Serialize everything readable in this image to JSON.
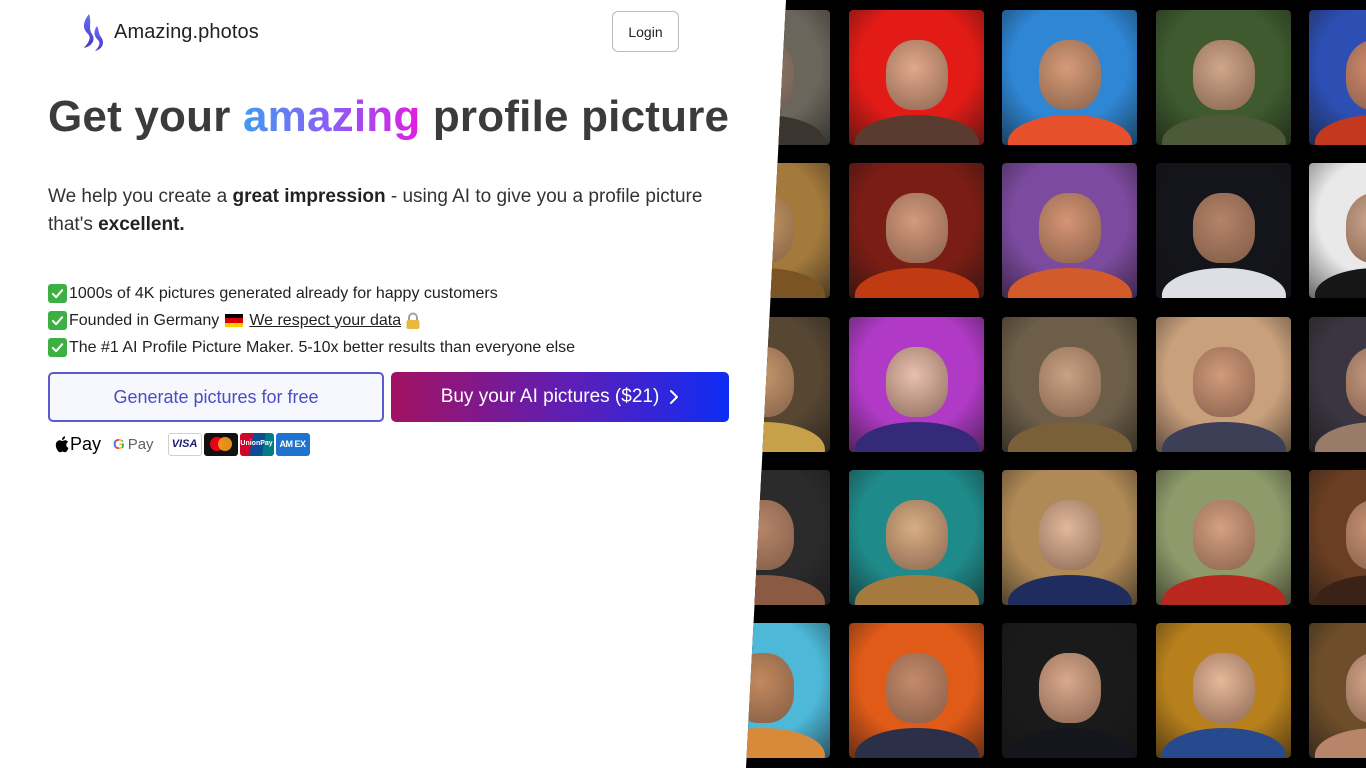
{
  "header": {
    "brand": "Amazing.photos",
    "login_label": "Login"
  },
  "hero": {
    "title_part1": "Get your ",
    "title_highlight": "amazing",
    "title_part2": " profile picture",
    "subtitle_part1": "We help you create a ",
    "subtitle_bold1": "great impression",
    "subtitle_part2": " - using AI to give you a profile picture that's ",
    "subtitle_bold2": "excellent."
  },
  "features": [
    {
      "text": "1000s of 4K pictures generated already for happy customers"
    },
    {
      "text": "Founded in Germany",
      "link": "We respect your data"
    },
    {
      "text": "The #1 AI Profile Picture Maker. 5-10x better results than everyone else"
    }
  ],
  "cta": {
    "free_label": "Generate pictures for free",
    "buy_label": "Buy your AI pictures ($21)"
  },
  "payments": {
    "apple_pay": "Pay",
    "google_pay": "Pay",
    "visa": "VISA",
    "unionpay": "UnionPay",
    "amex": "AM EX"
  },
  "gallery": {
    "tiles": [
      {
        "bg": "#6b665c",
        "face": "#8d8072",
        "shirt": "#3a352f"
      },
      {
        "bg": "#e21b16",
        "face": "#e2a88a",
        "shirt": "#5a3b30"
      },
      {
        "bg": "#2e86d4",
        "face": "#d69b78",
        "shirt": "#e6502a"
      },
      {
        "bg": "#3e5a2e",
        "face": "#cfa78a",
        "shirt": "#4d5a3a"
      },
      {
        "bg": "#2d4fb3",
        "face": "#d28c6d",
        "shirt": "#c2391f"
      },
      {
        "bg": "#a37a3c",
        "face": "#c99a64",
        "shirt": "#7a5424"
      },
      {
        "bg": "#7a1d14",
        "face": "#d49a7c",
        "shirt": "#c13b12"
      },
      {
        "bg": "#7c4a9e",
        "face": "#d59574",
        "shirt": "#d35a2a"
      },
      {
        "bg": "#14151a",
        "face": "#b58468",
        "shirt": "#dddfe5"
      },
      {
        "bg": "#e9e9e9",
        "face": "#cfa88e",
        "shirt": "#161616"
      },
      {
        "bg": "#564632",
        "face": "#c89a6e",
        "shirt": "#c7a04a"
      },
      {
        "bg": "#b03ac5",
        "face": "#e8c0b0",
        "shirt": "#352a7a"
      },
      {
        "bg": "#6c5e48",
        "face": "#c9a282",
        "shirt": "#7a6038"
      },
      {
        "bg": "#c9a07c",
        "face": "#d19a7a",
        "shirt": "#3c3f55"
      },
      {
        "bg": "#3a3540",
        "face": "#c59a80",
        "shirt": "#9a7a68"
      },
      {
        "bg": "#2b2b2b",
        "face": "#b8866a",
        "shirt": "#8a5a42"
      },
      {
        "bg": "#1f8a8a",
        "face": "#d8ae84",
        "shirt": "#a57a3e"
      },
      {
        "bg": "#b08a56",
        "face": "#e1b89a",
        "shirt": "#1e2c5e"
      },
      {
        "bg": "#8e9a6a",
        "face": "#d5a080",
        "shirt": "#b8281e"
      },
      {
        "bg": "#6a3e22",
        "face": "#c99474",
        "shirt": "#3a2216"
      },
      {
        "bg": "#4db8d8",
        "face": "#c28a5e",
        "shirt": "#d68a3a"
      },
      {
        "bg": "#e05a18",
        "face": "#c58a6a",
        "shirt": "#2b2f48"
      },
      {
        "bg": "#1a1a1a",
        "face": "#d9a98c",
        "shirt": "#14161c"
      },
      {
        "bg": "#b8801c",
        "face": "#e6b898",
        "shirt": "#274a8e"
      },
      {
        "bg": "#6e4e2a",
        "face": "#d6a88a",
        "shirt": "#b8846a"
      }
    ]
  }
}
